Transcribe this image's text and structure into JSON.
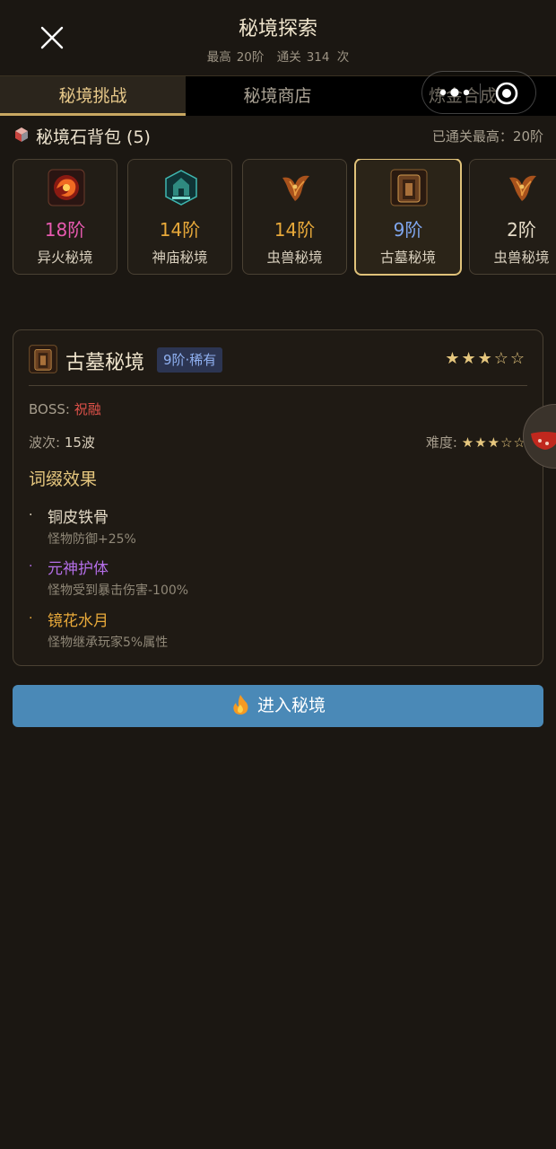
{
  "header": {
    "title": "秘境探索",
    "max_label": "最高",
    "max_value": "20阶",
    "clear_label": "通关",
    "clear_value": "314 次"
  },
  "tabs": [
    {
      "label": "秘境挑战",
      "active": true
    },
    {
      "label": "秘境商店",
      "active": false
    },
    {
      "label": "炼金合成",
      "active": false
    }
  ],
  "pack": {
    "title": "秘境石背包 (5)",
    "cleared_text": "已通关最高：20阶"
  },
  "stones": [
    {
      "level": "18阶",
      "name": "异火秘境",
      "level_color": "#e85ab0",
      "icon": "fire-vortex-icon"
    },
    {
      "level": "14阶",
      "name": "神庙秘境",
      "level_color": "#e8a93a",
      "icon": "temple-icon"
    },
    {
      "level": "14阶",
      "name": "虫兽秘境",
      "level_color": "#e8a93a",
      "icon": "beast-icon"
    },
    {
      "level": "9阶",
      "name": "古墓秘境",
      "level_color": "#7fa6ee",
      "icon": "tomb-icon"
    },
    {
      "level": "2阶",
      "name": "虫兽秘境",
      "level_color": "#e6dcc8",
      "icon": "beast-icon"
    }
  ],
  "detail": {
    "name": "古墓秘境",
    "badge": "9阶·稀有",
    "stars": "★★★☆☆",
    "boss_label": "BOSS: ",
    "boss_value": "祝融",
    "wave_label": "波次: ",
    "wave_value": "15波",
    "difficulty_label": "难度: ",
    "difficulty_stars": "★★★☆☆",
    "affix_title": "词缀效果",
    "affixes": [
      {
        "name": "铜皮铁骨",
        "desc": "怪物防御+25%",
        "color": "#e6dcc8"
      },
      {
        "name": "元神护体",
        "desc": "怪物受到暴击伤害-100%",
        "color": "#b46ee8"
      },
      {
        "name": "镜花水月",
        "desc": "怪物继承玩家5%属性",
        "color": "#e8a93a"
      }
    ]
  },
  "enter_button": {
    "label": "进入秘境"
  }
}
